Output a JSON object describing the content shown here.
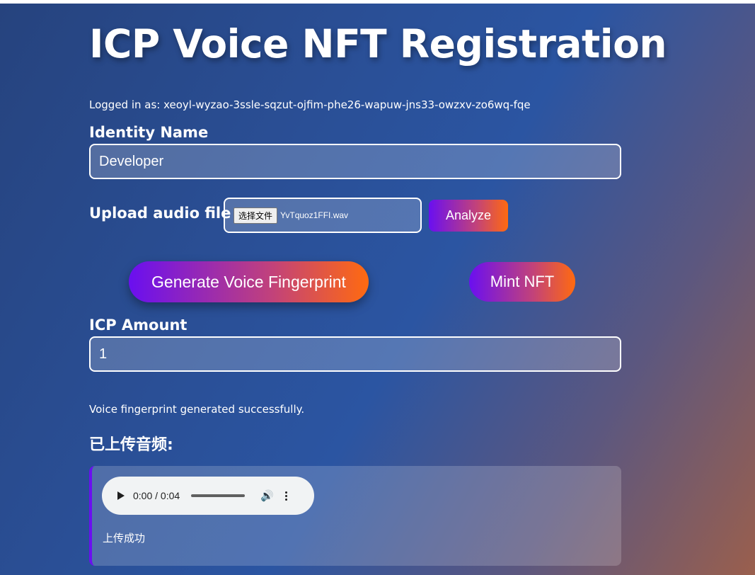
{
  "page": {
    "title": "ICP Voice NFT Registration",
    "logged_in_text": "Logged in as: xeoyl-wyzao-3ssle-sqzut-ojfim-phe26-wapuw-jns33-owzxv-zo6wq-fqe"
  },
  "identity": {
    "label": "Identity Name",
    "value": "Developer"
  },
  "upload": {
    "label": "Upload audio file",
    "choose_button": "选择文件",
    "file_name": "YvTquoz1FFI.wav",
    "analyze_button": "Analyze"
  },
  "actions": {
    "generate_button": "Generate Voice Fingerprint",
    "mint_button": "Mint NFT"
  },
  "amount": {
    "label": "ICP Amount",
    "value": "1"
  },
  "status_message": "Voice fingerprint generated successfully.",
  "uploaded": {
    "title": "已上传音频:",
    "player_time": "0:00 / 0:04",
    "message": "上传成功"
  },
  "colors": {
    "gradient_start": "#6a0ff0",
    "gradient_end": "#ff6a10",
    "background": "#2a4f96"
  }
}
